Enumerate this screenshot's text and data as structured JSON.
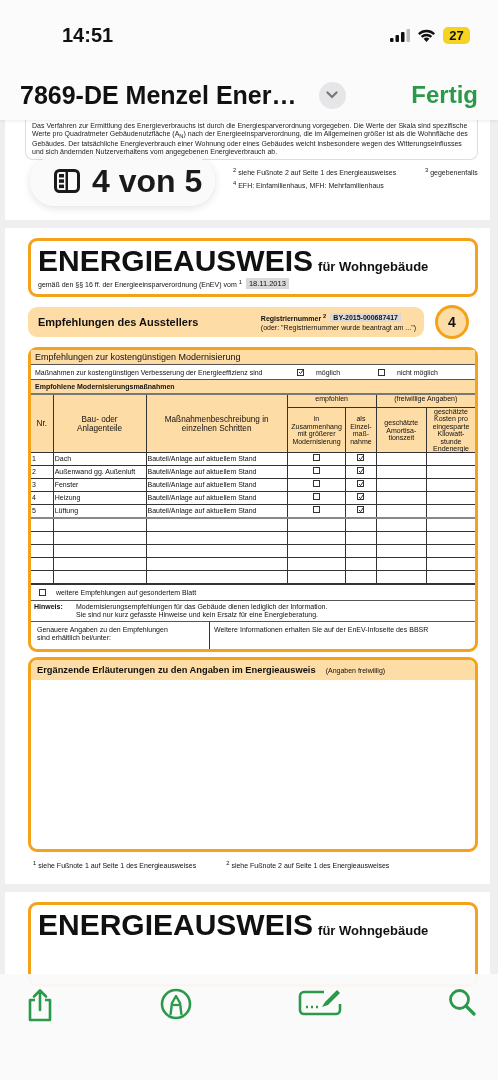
{
  "status_bar": {
    "time": "14:51",
    "battery": "27"
  },
  "nav": {
    "title": "7869-DE Menzel Ener…",
    "done": "Fertig"
  },
  "page_badge": {
    "text": "4 von 5"
  },
  "prev_page": {
    "paragraph": "Das Verfahren zur Ermittlung des Energieverbrauchs ist durch die Energiesparverordnung vorgegeben. Die Werte der Skala sind spezifische Werte pro Quadratmeter Gebäudenutzfläche (A$_{N}$) nach der Energieeinsparverordnung, die im Allgemeinen größer ist als die Wohnfläche des Gebäudes. Der tatsächliche Energieverbrauch einer Wohnung oder eines Gebäudes weicht insbesondere wegen des Witterungseinflusses und sich ändernden Nutzerverhaltens vom angegebenen Energieverbrauch ab.",
    "footnotes": [
      "$^{2}$ siehe Fußnote 2 auf Seite 1 des Energieausweises",
      "$^{3}$ gegebenenfalls",
      "$^{4}$ EFH: Einfamilienhaus, MFH: Mehrfamilienhaus"
    ]
  },
  "page": {
    "title": "ENERGIEAUSWEIS",
    "subtitle": "für Wohngebäude",
    "regulation": "gemäß den §§ 16 ff. der Energieeinsparverordnung (EnEV) vom $^{1}$",
    "date": "18.11.2013",
    "section": {
      "title": "Empfehlungen des Ausstellers",
      "reg_label": "Registriernummer $^{2}$",
      "reg_number": "BY-2015-000687417",
      "reg_note": "(oder: \"Registriernummer wurde beantragt am ...\")",
      "page_number": "4"
    },
    "recommendations": {
      "title": "Empfehlungen zur kostengünstigen Modernisierung",
      "possible_text": "Maßnahmen zur kostengünstigen Verbesserung der Energieeffizienz sind",
      "options": [
        {
          "label": "möglich",
          "checked": true
        },
        {
          "label": "nicht möglich",
          "checked": false
        }
      ],
      "measures_title": "Empfohlene Modernisierungsmaßnahmen",
      "columns": {
        "nr": "Nr.",
        "part": "Bau- oder\nAnlagenteile",
        "description": "Maßnahmenbeschreibung in\neinzelnen Schritten",
        "recommended": "empfohlen",
        "combined": "in\nZusammenhang\nmit größerer\nModernisierung",
        "single": "als\nEinzel-\nmaß-\nnahme",
        "optional": "(freiwillige Angaben)",
        "payback": "geschätzte\nAmortisa-\ntionszeit",
        "cost": "geschätzte\nKosten pro\neingesparte\nKilowatt-\nstunde\nEndenergie"
      },
      "rows": [
        {
          "nr": "1",
          "part": "Dach",
          "description": "Bauteil/Anlage auf aktuellem Stand",
          "combined": false,
          "single": true
        },
        {
          "nr": "2",
          "part": "Außenwand gg. Außenluft",
          "description": "Bauteil/Anlage auf aktuellem Stand",
          "combined": false,
          "single": true
        },
        {
          "nr": "3",
          "part": "Fenster",
          "description": "Bauteil/Anlage auf aktuellem Stand",
          "combined": false,
          "single": true
        },
        {
          "nr": "4",
          "part": "Heizung",
          "description": "Bauteil/Anlage auf aktuellem Stand",
          "combined": false,
          "single": true
        },
        {
          "nr": "5",
          "part": "Lüftung",
          "description": "Bauteil/Anlage auf aktuellem Stand",
          "combined": false,
          "single": true
        }
      ],
      "more_sheet": {
        "label": "weitere Empfehlungen auf gesondertem Blatt",
        "checked": false
      },
      "note_label": "Hinweis:",
      "note": "Modernisierungsempfehlungen für das Gebäude dienen lediglich der Information.\nSie sind nur kurz gefasste Hinweise und kein Ersatz für eine Energieberatung.",
      "details_label": "Genauere Angaben zu den Empfehlungen\nsind erhältlich bei/unter:",
      "info": "Weitere Informationen erhalten Sie auf der EnEV-Infoseite des BBSR"
    },
    "explanations": {
      "title": "Ergänzende Erläuterungen zu den Angaben im Energieausweis",
      "note": "(Angaben freiwillig)"
    },
    "footnotes": [
      "$^{1}$ siehe Fußnote 1 auf Seite 1 des Energieausweises",
      "$^{2}$ siehe Fußnote 2 auf Seite 1 des Energieausweises"
    ]
  },
  "next_page": {
    "title": "ENERGIEAUSWEIS",
    "subtitle": "für Wohngebäude"
  }
}
